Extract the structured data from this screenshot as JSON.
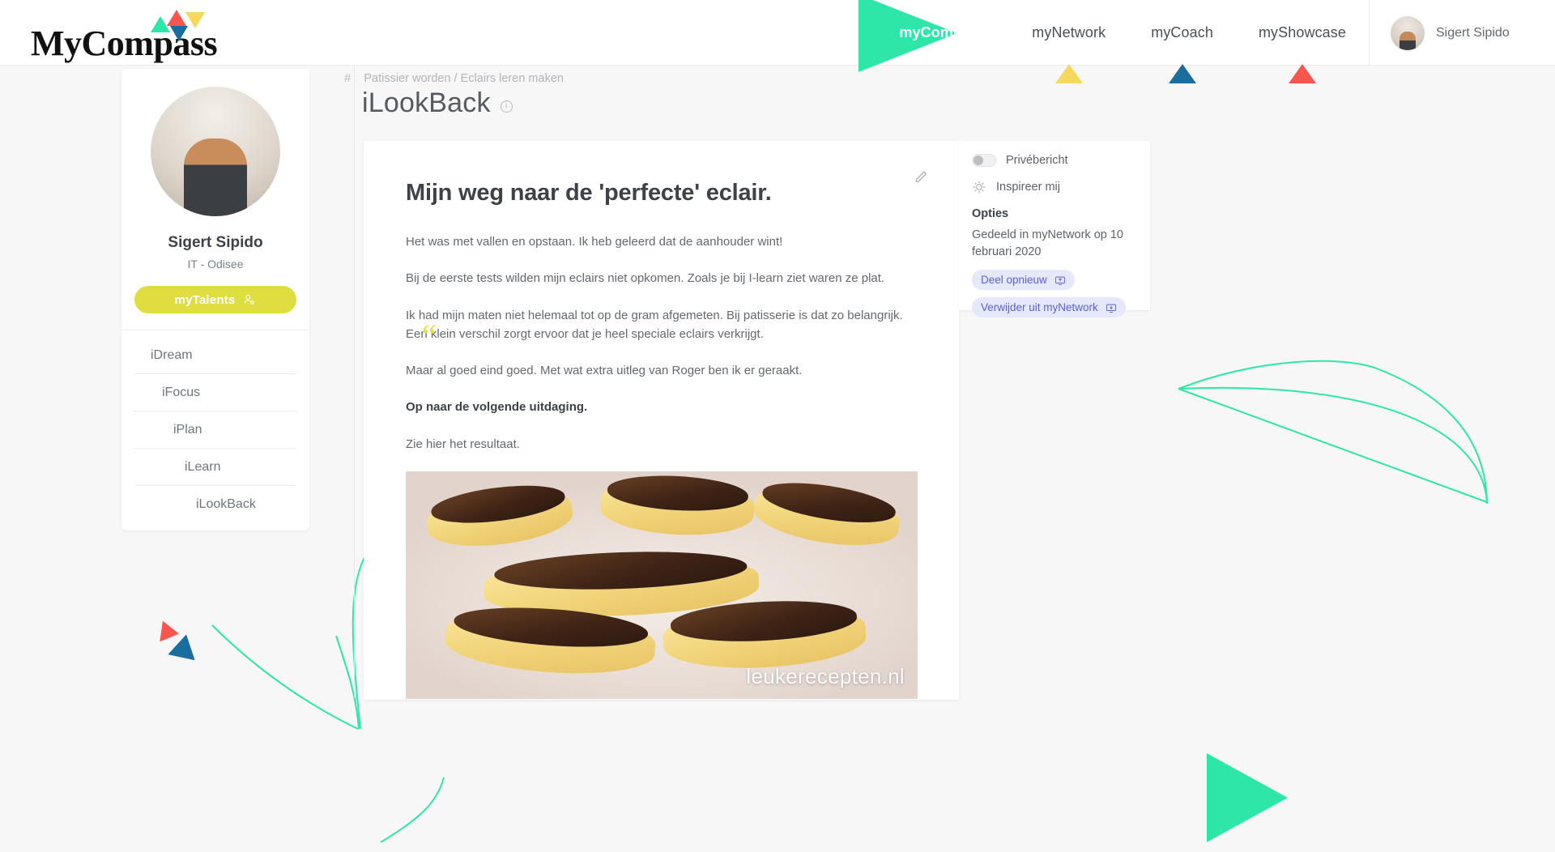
{
  "brand": {
    "logo_my": "My",
    "logo_compass": "Compass"
  },
  "topnav": {
    "items": [
      {
        "label": "myCompass",
        "active": true,
        "marker_color": "#2ee6a8"
      },
      {
        "label": "myNetwork",
        "active": false,
        "marker_color": "#f6d85f"
      },
      {
        "label": "myCoach",
        "active": false,
        "marker_color": "#1a6e9e"
      },
      {
        "label": "myShowcase",
        "active": false,
        "marker_color": "#f9564f"
      }
    ],
    "user_name": "Sigert Sipido"
  },
  "sidebar": {
    "profile_name": "Sigert Sipido",
    "profile_subtitle": "IT - Odisee",
    "talents_button": "myTalents",
    "items": [
      {
        "label": "iDream"
      },
      {
        "label": "iFocus"
      },
      {
        "label": "iPlan"
      },
      {
        "label": "iLearn"
      },
      {
        "label": "iLookBack"
      }
    ]
  },
  "header": {
    "breadcrumb_hash": "#",
    "breadcrumb": "Patissier worden / Eclairs leren maken",
    "title": "iLookBack"
  },
  "article": {
    "title": "Mijn weg naar de 'perfecte' eclair.",
    "paragraphs": [
      {
        "text": "Het was met vallen en opstaan. Ik heb geleerd dat de aanhouder wint!",
        "bold": false
      },
      {
        "text": "Bij de eerste tests wilden mijn eclairs niet opkomen. Zoals je bij I-learn ziet waren ze plat.",
        "bold": false
      },
      {
        "text": "Ik had mijn maten niet helemaal tot op de gram afgemeten. Bij patisserie is dat zo belangrijk. Een klein verschil zorgt ervoor dat je heel speciale eclairs verkrijgt.",
        "bold": false
      },
      {
        "text": "Maar al goed eind goed. Met wat extra uitleg van Roger ben ik er geraakt.",
        "bold": false
      },
      {
        "text": "Op naar de volgende uitdaging.",
        "bold": true
      },
      {
        "text": "Zie hier het resultaat.",
        "bold": false
      }
    ],
    "image_watermark": "leukerecepten.nl"
  },
  "options_panel": {
    "private_toggle_label": "Privébericht",
    "inspire_label": "Inspireer mij",
    "options_heading": "Opties",
    "shared_note": "Gedeeld in myNetwork op 10 februari 2020",
    "chips": [
      {
        "label": "Deel opnieuw",
        "icon": "share-screen-icon"
      },
      {
        "label": "Verwijder uit myNetwork",
        "icon": "remove-screen-icon"
      }
    ]
  },
  "colors": {
    "green": "#2ee6a8",
    "yellow": "#f6d85f",
    "blue": "#1a6e9e",
    "red": "#f9564f",
    "talents_yellow": "#dede40",
    "chip_bg": "#e6e8fb",
    "chip_text": "#5b62d6"
  }
}
